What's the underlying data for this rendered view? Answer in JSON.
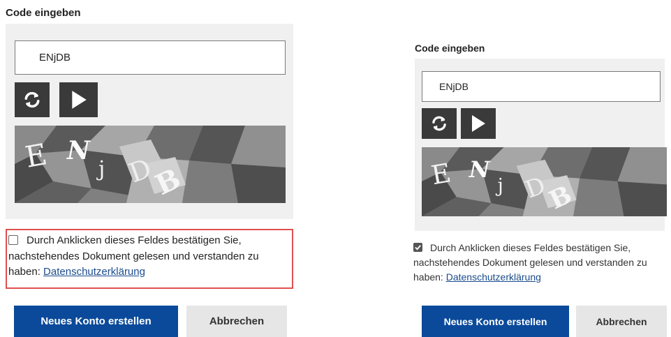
{
  "left": {
    "title": "Code eingeben",
    "code_value": "ENjDB",
    "consent_text": "Durch Anklicken dieses Feldes bestätigen Sie, nachstehendes Dokument gelesen und verstanden zu haben: ",
    "consent_link": "Datenschutzerklärung",
    "checkbox_checked": false,
    "highlight_color": "#e05050",
    "primary_button": "Neues Konto erstellen",
    "secondary_button": "Abbrechen"
  },
  "right": {
    "title": "Code eingeben",
    "code_value": "ENjDB",
    "consent_text": "Durch Anklicken dieses Feldes bestätigen Sie, nachstehendes Dokument gelesen und verstanden zu haben: ",
    "consent_link": "Datenschutzerklärung",
    "checkbox_checked": true,
    "primary_button": "Neues Konto erstellen",
    "secondary_button": "Abbrechen"
  },
  "icons": {
    "refresh": "refresh-icon",
    "play": "play-icon"
  },
  "colors": {
    "primary": "#0b4a9a",
    "secondary": "#e6e6e6",
    "panel_bg": "#f0f0f0",
    "icon_button_bg": "#3a3a3a",
    "link": "#1a4b8c"
  }
}
